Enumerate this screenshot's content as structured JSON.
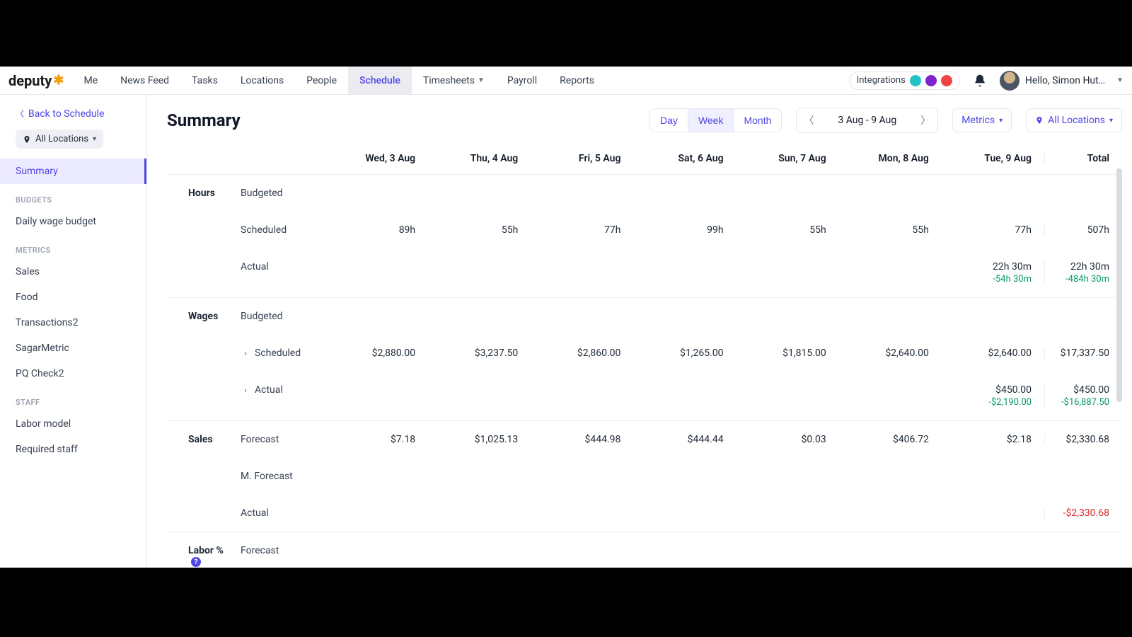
{
  "brand": {
    "name": "deputy"
  },
  "nav": {
    "items": [
      "Me",
      "News Feed",
      "Tasks",
      "Locations",
      "People",
      "Schedule",
      "Timesheets",
      "Payroll",
      "Reports"
    ],
    "active": "Schedule",
    "timesheets_has_caret": true
  },
  "topright": {
    "integrations_label": "Integrations",
    "greeting": "Hello, Simon Hut…"
  },
  "sidebar": {
    "back_label": "Back to Schedule",
    "location_pill": "All Locations",
    "summary_label": "Summary",
    "budgets_heading": "BUDGETS",
    "budgets_items": [
      "Daily wage budget"
    ],
    "metrics_heading": "METRICS",
    "metrics_items": [
      "Sales",
      "Food",
      "Transactions2",
      "SagarMetric",
      "PQ Check2"
    ],
    "staff_heading": "STAFF",
    "staff_items": [
      "Labor model",
      "Required staff"
    ]
  },
  "header": {
    "title": "Summary",
    "granularity": {
      "day": "Day",
      "week": "Week",
      "month": "Month",
      "selected": "Week"
    },
    "date_range": "3 Aug - 9 Aug",
    "metrics_btn": "Metrics",
    "locations_btn": "All Locations"
  },
  "columns": [
    "Wed, 3 Aug",
    "Thu, 4 Aug",
    "Fri, 5 Aug",
    "Sat, 6 Aug",
    "Sun, 7 Aug",
    "Mon, 8 Aug",
    "Tue, 9 Aug",
    "Total"
  ],
  "sections": {
    "hours": {
      "label": "Hours",
      "budgeted": {
        "label": "Budgeted",
        "vals": [
          "",
          "",
          "",
          "",
          "",
          "",
          "",
          ""
        ]
      },
      "scheduled": {
        "label": "Scheduled",
        "vals": [
          "89h",
          "55h",
          "77h",
          "99h",
          "55h",
          "55h",
          "77h",
          "507h"
        ]
      },
      "actual": {
        "label": "Actual",
        "vals": [
          "",
          "",
          "",
          "",
          "",
          "",
          ""
        ],
        "tue": {
          "top": "22h 30m",
          "delta": "-54h 30m"
        },
        "total": {
          "top": "22h 30m",
          "delta": "-484h 30m"
        }
      }
    },
    "wages": {
      "label": "Wages",
      "budgeted": {
        "label": "Budgeted",
        "vals": [
          "",
          "",
          "",
          "",
          "",
          "",
          "",
          ""
        ]
      },
      "scheduled": {
        "label": "Scheduled",
        "expandable": true,
        "vals": [
          "$2,880.00",
          "$3,237.50",
          "$2,860.00",
          "$1,265.00",
          "$1,815.00",
          "$2,640.00",
          "$2,640.00",
          "$17,337.50"
        ]
      },
      "actual": {
        "label": "Actual",
        "expandable": true,
        "vals": [
          "",
          "",
          "",
          "",
          "",
          "",
          ""
        ],
        "tue": {
          "top": "$450.00",
          "delta": "-$2,190.00"
        },
        "total": {
          "top": "$450.00",
          "delta": "-$16,887.50"
        }
      }
    },
    "sales": {
      "label": "Sales",
      "forecast": {
        "label": "Forecast",
        "vals": [
          "$7.18",
          "$1,025.13",
          "$444.98",
          "$444.44",
          "$0.03",
          "$406.72",
          "$2.18",
          "$2,330.68"
        ]
      },
      "mforecast": {
        "label": "M. Forecast",
        "vals": [
          "",
          "",
          "",
          "",
          "",
          "",
          "",
          ""
        ]
      },
      "actual": {
        "label": "Actual",
        "vals": [
          "",
          "",
          "",
          "",
          "",
          "",
          "",
          ""
        ],
        "total_red": "-$2,330.68"
      }
    },
    "labor": {
      "label": "Labor %",
      "forecast_label": "Forecast"
    }
  }
}
